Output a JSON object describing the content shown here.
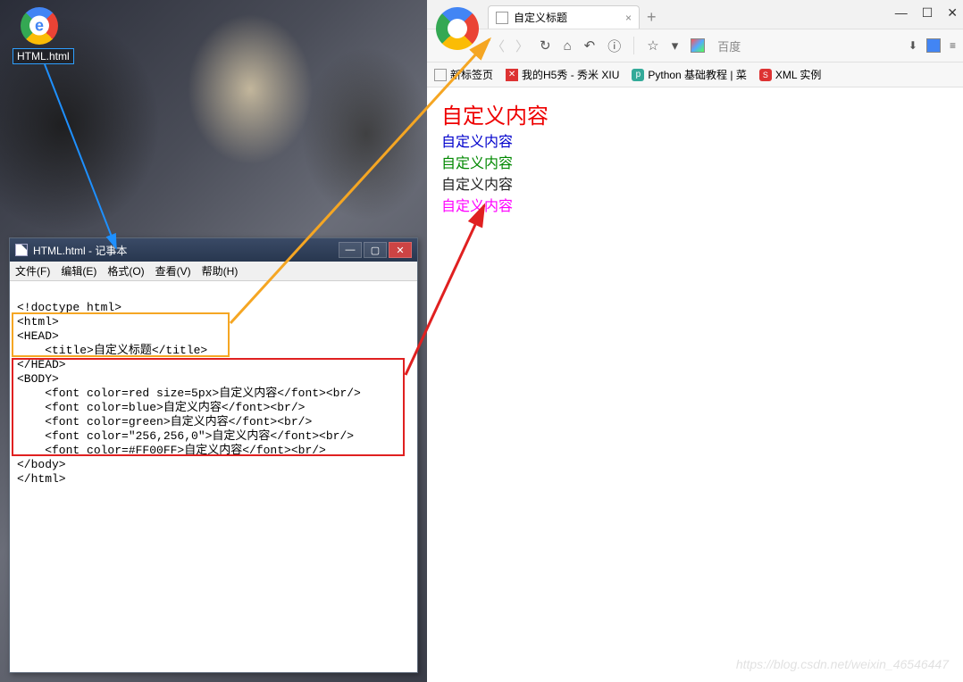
{
  "desktop": {
    "file_name": "HTML.html"
  },
  "notepad": {
    "title": "HTML.html - 记事本",
    "menu": {
      "file": "文件(F)",
      "edit": "编辑(E)",
      "format": "格式(O)",
      "view": "查看(V)",
      "help": "帮助(H)"
    },
    "code": {
      "l1": "<!doctype html>",
      "l2": "<html>",
      "l3": "<HEAD>",
      "l4": "    <title>自定义标题</title>",
      "l5": "</HEAD>",
      "l6": "<BODY>",
      "l7": "    <font color=red size=5px>自定义内容</font><br/>",
      "l8": "    <font color=blue>自定义内容</font><br/>",
      "l9": "    <font color=green>自定义内容</font><br/>",
      "l10": "    <font color=\"256,256,0\">自定义内容</font><br/>",
      "l11": "    <font color=#FF00FF>自定义内容</font><br/>",
      "l12": "</body>",
      "l13": "</html>"
    }
  },
  "browser": {
    "tab_title": "自定义标题",
    "search_placeholder": "百度",
    "bookmarks": {
      "b1": "新标签页",
      "b2": "我的H5秀 - 秀米 XIU",
      "b3": "Python 基础教程 | 菜",
      "b4": "XML 实例"
    },
    "page": {
      "p1": "自定义内容",
      "p2": "自定义内容",
      "p3": "自定义内容",
      "p4": "自定义内容",
      "p5": "自定义内容"
    }
  },
  "watermark": "https://blog.csdn.net/weixin_46546447"
}
